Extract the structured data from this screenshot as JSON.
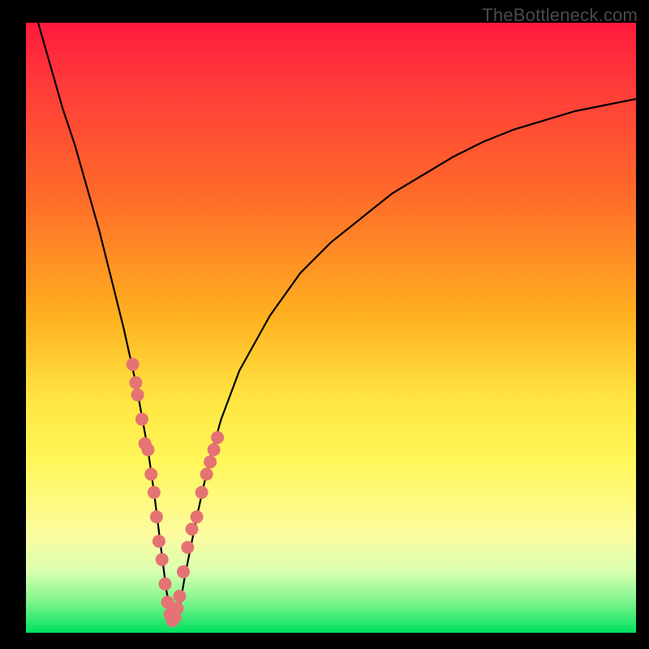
{
  "watermark": {
    "text": "TheBottleneck.com"
  },
  "colors": {
    "marker": "#e57373",
    "curve": "#000000",
    "gradient_top": "#ff1a3c",
    "gradient_bottom": "#00e060"
  },
  "chart_data": {
    "type": "line",
    "title": "",
    "xlabel": "",
    "ylabel": "",
    "xlim": [
      0,
      100
    ],
    "ylim": [
      0,
      100
    ],
    "grid": false,
    "legend": false,
    "x": [
      0,
      2,
      4,
      6,
      8,
      10,
      12,
      14,
      16,
      18,
      20,
      21,
      22,
      23,
      24,
      25,
      26,
      28,
      30,
      32,
      35,
      40,
      45,
      50,
      55,
      60,
      65,
      70,
      75,
      80,
      85,
      90,
      95,
      100
    ],
    "values": [
      106,
      100,
      93,
      86,
      80,
      73,
      66,
      58,
      50,
      41,
      30,
      23,
      15,
      7,
      2,
      3,
      9,
      19,
      28,
      35,
      43,
      52,
      59,
      64,
      68,
      72,
      75,
      78,
      80.5,
      82.5,
      84,
      85.5,
      86.5,
      87.5
    ],
    "markers": {
      "x": [
        17.5,
        18.0,
        18.3,
        19.0,
        19.5,
        20.0,
        20.5,
        21.0,
        21.4,
        21.8,
        22.3,
        22.8,
        23.2,
        23.6,
        24.0,
        24.4,
        24.8,
        25.2,
        25.8,
        26.5,
        27.2,
        28.0,
        28.8,
        29.6,
        30.2,
        30.8,
        31.4
      ],
      "y": [
        44,
        41,
        39,
        35,
        31,
        30,
        26,
        23,
        19,
        15,
        12,
        8,
        5,
        3,
        2,
        2.5,
        4,
        6,
        10,
        14,
        17,
        19,
        23,
        26,
        28,
        30,
        32
      ]
    }
  }
}
